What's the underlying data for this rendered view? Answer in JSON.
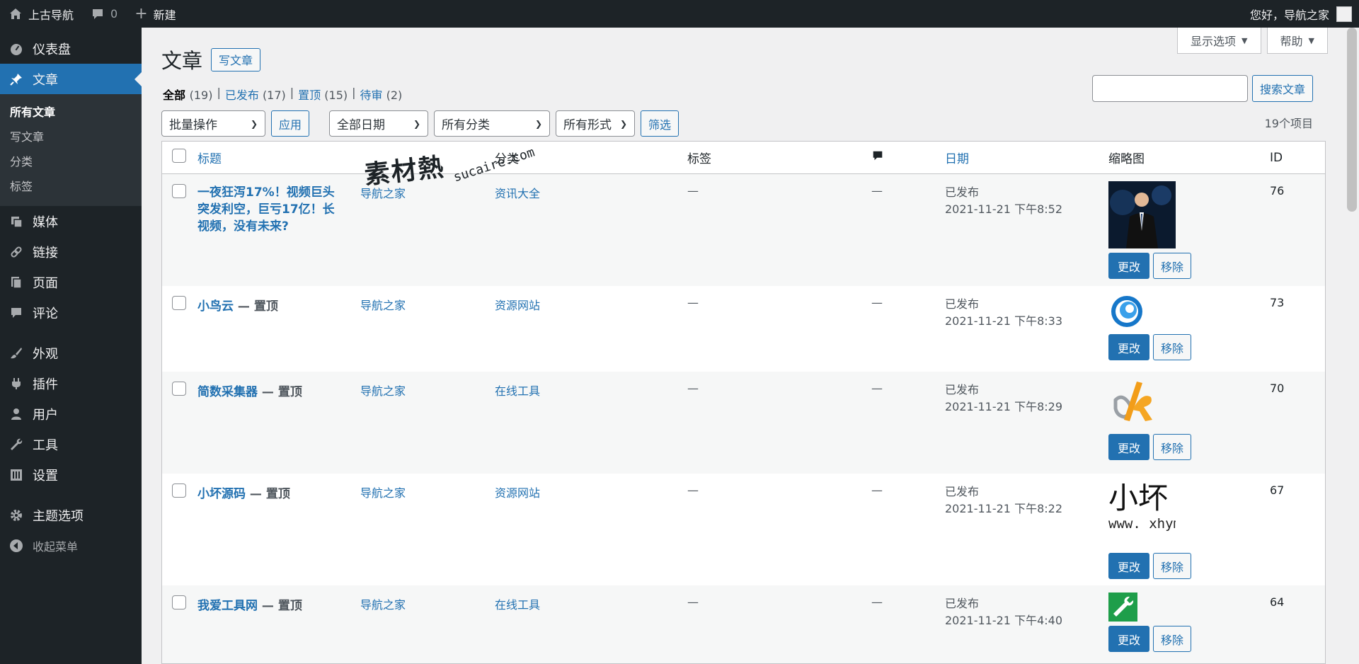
{
  "adminbar": {
    "site_name": "上古导航",
    "comments_count": "0",
    "new_label": "新建",
    "greeting": "您好，导航之家"
  },
  "sidebar": {
    "items": [
      {
        "label": "仪表盘",
        "icon": "dashboard-icon"
      },
      {
        "label": "文章",
        "icon": "pin-icon"
      },
      {
        "label": "媒体",
        "icon": "media-icon"
      },
      {
        "label": "链接",
        "icon": "link-icon"
      },
      {
        "label": "页面",
        "icon": "page-icon"
      },
      {
        "label": "评论",
        "icon": "comment-icon"
      },
      {
        "label": "外观",
        "icon": "brush-icon"
      },
      {
        "label": "插件",
        "icon": "plugin-icon"
      },
      {
        "label": "用户",
        "icon": "user-icon"
      },
      {
        "label": "工具",
        "icon": "wrench-icon"
      },
      {
        "label": "设置",
        "icon": "settings-icon"
      },
      {
        "label": "主题选项",
        "icon": "gear-icon"
      }
    ],
    "submenu": [
      "所有文章",
      "写文章",
      "分类",
      "标签"
    ],
    "collapse_label": "收起菜单"
  },
  "screen_tabs": {
    "options": "显示选项",
    "help": "帮助"
  },
  "page": {
    "title": "文章",
    "add_new": "写文章"
  },
  "views": [
    {
      "label": "全部",
      "count": "(19)"
    },
    {
      "label": "已发布",
      "count": "(17)"
    },
    {
      "label": "置顶",
      "count": "(15)"
    },
    {
      "label": "待审",
      "count": "(2)"
    }
  ],
  "search": {
    "button": "搜索文章"
  },
  "filters": {
    "bulk": "批量操作",
    "apply": "应用",
    "date": "全部日期",
    "category": "所有分类",
    "format": "所有形式",
    "filter": "筛选"
  },
  "items_count": "19个项目",
  "table": {
    "headers": {
      "title": "标题",
      "category": "分类",
      "tags": "标签",
      "date": "日期",
      "thumbnail": "缩略图",
      "id": "ID"
    },
    "rows": [
      {
        "title": "一夜狂泻17%！视频巨头突发利空，巨亏17亿！长视频，没有未来?",
        "state": "",
        "author": "导航之家",
        "category": "资讯大全",
        "tags": "—",
        "comments": "—",
        "status": "已发布",
        "date": "2021-11-21 下午8:52",
        "edit": "更改",
        "remove": "移除",
        "id": "76"
      },
      {
        "title": "小鸟云",
        "state": " — 置顶",
        "author": "导航之家",
        "category": "资源网站",
        "tags": "—",
        "comments": "—",
        "status": "已发布",
        "date": "2021-11-21 下午8:33",
        "edit": "更改",
        "remove": "移除",
        "id": "73"
      },
      {
        "title": "简数采集器",
        "state": " — 置顶",
        "author": "导航之家",
        "category": "在线工具",
        "tags": "—",
        "comments": "—",
        "status": "已发布",
        "date": "2021-11-21 下午8:29",
        "edit": "更改",
        "remove": "移除",
        "id": "70"
      },
      {
        "title": "小坏源码",
        "state": " — 置顶",
        "author": "导航之家",
        "category": "资源网站",
        "tags": "—",
        "comments": "—",
        "status": "已发布",
        "date": "2021-11-21 下午8:22",
        "edit": "更改",
        "remove": "移除",
        "id": "67"
      },
      {
        "title": "我爱工具网",
        "state": " — 置顶",
        "author": "导航之家",
        "category": "在线工具",
        "tags": "—",
        "comments": "—",
        "status": "已发布",
        "date": "2021-11-21 下午4:40",
        "edit": "更改",
        "remove": "移除",
        "id": "64"
      }
    ],
    "thumb_text_line1": "小坏",
    "thumb_text_line2": "www. xhym"
  },
  "watermark": {
    "main": "素材熱",
    "sub": "sucaire.com"
  },
  "colors": {
    "accent": "#2271b1",
    "adminbar": "#1d2327",
    "sidebar": "#1d2327"
  }
}
